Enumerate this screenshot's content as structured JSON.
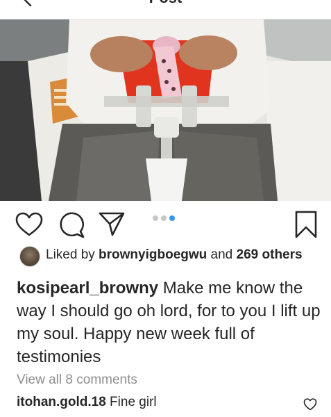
{
  "header": {
    "title": "Post",
    "back_icon": "back-arrow-icon"
  },
  "photo": {
    "description_icon": "post-photo"
  },
  "actions": {
    "like_icon": "heart-icon",
    "comment_icon": "comment-icon",
    "share_icon": "share-icon",
    "save_icon": "bookmark-icon",
    "carousel_count": 3,
    "carousel_active_index": 2
  },
  "likes": {
    "prefix": "Liked by ",
    "user": "brownyigboegwu",
    "middle": " and ",
    "others": "269 others"
  },
  "caption": {
    "username": "kosipearl_browny",
    "text": " Make me know the way I should go oh lord, for to you I lift up my soul. Happy new week full of testimonies"
  },
  "comments": {
    "view_all": "View all 8 comments",
    "items": [
      {
        "username": "itohan.gold.18",
        "text": " Fine girl"
      }
    ]
  },
  "colors": {
    "text": "#262626",
    "muted": "#8e8e8e",
    "accent": "#3897f0"
  }
}
